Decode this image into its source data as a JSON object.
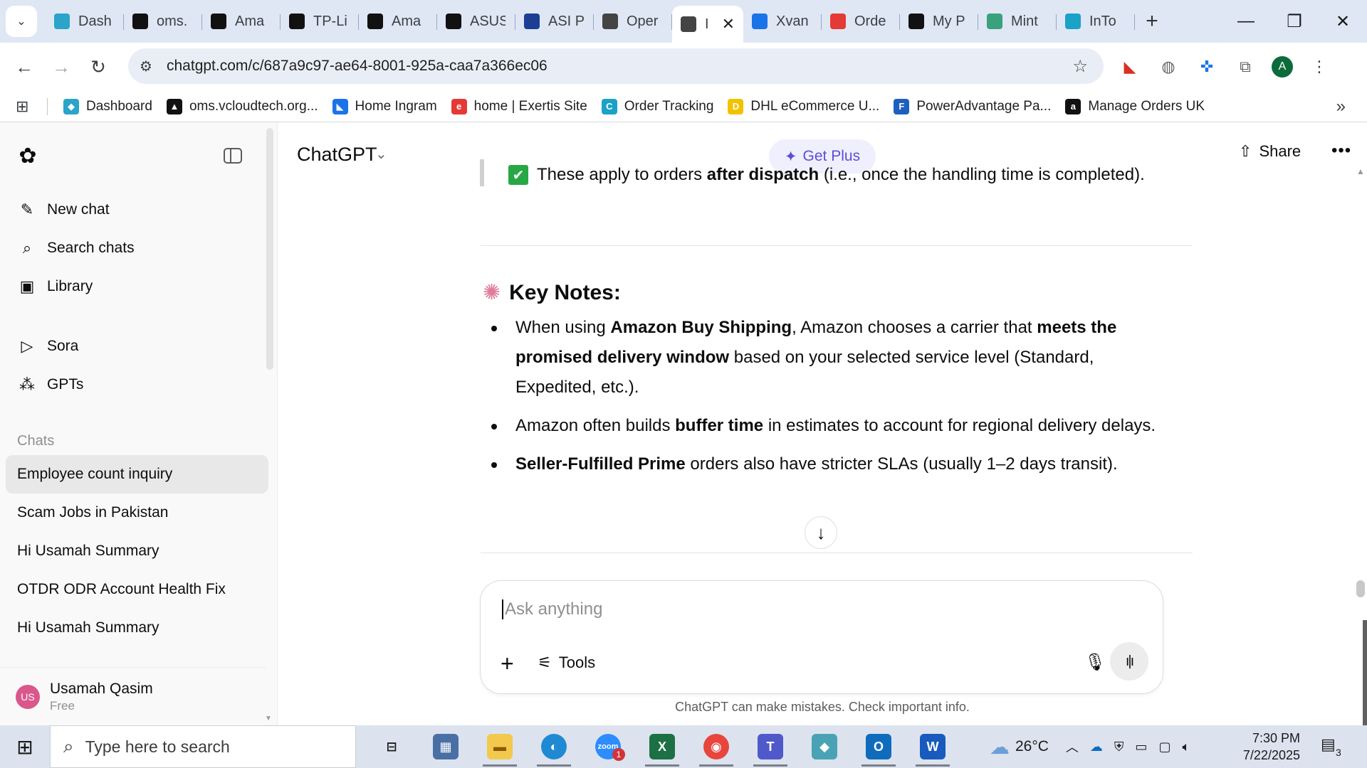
{
  "browser": {
    "tabs": [
      {
        "label": "Dash",
        "icon": "dashboard-favicon",
        "color": "#2aa4c8"
      },
      {
        "label": "oms.",
        "icon": "oms-favicon",
        "color": "#111111"
      },
      {
        "label": "Ama",
        "icon": "amazon-favicon",
        "color": "#111111"
      },
      {
        "label": "TP-Li",
        "icon": "amazon-favicon",
        "color": "#111111"
      },
      {
        "label": "Ama",
        "icon": "amazon-favicon",
        "color": "#111111"
      },
      {
        "label": "ASUS",
        "icon": "amazon-favicon",
        "color": "#111111"
      },
      {
        "label": "ASI P",
        "icon": "asi-favicon",
        "color": "#1c3f94"
      },
      {
        "label": "Oper",
        "icon": "openai-favicon",
        "color": "#444444"
      },
      {
        "label": "I",
        "icon": "openai-favicon",
        "color": "#444444",
        "active": true
      },
      {
        "label": "Xvan",
        "icon": "xvantage-favicon",
        "color": "#1a73e8"
      },
      {
        "label": "Orde",
        "icon": "exertis-favicon",
        "color": "#e53935"
      },
      {
        "label": "My P",
        "icon": "myp-favicon",
        "color": "#111111"
      },
      {
        "label": "Mint",
        "icon": "mint-favicon",
        "color": "#3aa17e"
      },
      {
        "label": "InTo",
        "icon": "into-favicon",
        "color": "#1aa2c7"
      }
    ],
    "url": "chatgpt.com/c/687a9c97-ae64-8001-925a-caa7a366ec06",
    "profile_initial": "A",
    "bookmarks": [
      {
        "label": "Dashboard",
        "color": "#2aa4c8",
        "glyph": "◆"
      },
      {
        "label": "oms.vcloudtech.org...",
        "color": "#111111",
        "glyph": "▲"
      },
      {
        "label": "Home Ingram",
        "color": "#1a73e8",
        "glyph": "◣"
      },
      {
        "label": "home | Exertis Site",
        "color": "#e53935",
        "glyph": "e"
      },
      {
        "label": "Order Tracking",
        "color": "#1aa2c7",
        "glyph": "C"
      },
      {
        "label": "DHL eCommerce U...",
        "color": "#f2c200",
        "glyph": "D"
      },
      {
        "label": "PowerAdvantage Pa...",
        "color": "#1f5fbf",
        "glyph": "F"
      },
      {
        "label": "Manage Orders UK",
        "color": "#111111",
        "glyph": "a"
      }
    ]
  },
  "sidebar": {
    "nav": [
      {
        "label": "New chat",
        "icon": "compose-icon",
        "glyph": "✎"
      },
      {
        "label": "Search chats",
        "icon": "search-icon",
        "glyph": "⌕"
      },
      {
        "label": "Library",
        "icon": "library-icon",
        "glyph": "▣"
      }
    ],
    "nav2": [
      {
        "label": "Sora",
        "icon": "play-icon",
        "glyph": "▷"
      },
      {
        "label": "GPTs",
        "icon": "grid-icon",
        "glyph": "⁂"
      }
    ],
    "section_title": "Chats",
    "chats": [
      "Employee count inquiry",
      "Scam Jobs in Pakistan",
      "Hi Usamah Summary",
      "OTDR ODR Account Health Fix",
      "Hi Usamah Summary"
    ],
    "user": {
      "initials": "US",
      "name": "Usamah Qasim",
      "plan": "Free"
    }
  },
  "header": {
    "model": "ChatGPT",
    "get_plus": "Get Plus",
    "share": "Share"
  },
  "message": {
    "check_line": {
      "pre": "These apply to orders ",
      "bold": "after dispatch",
      "post": " (i.e., once the handling time is completed)."
    },
    "heading": "Key Notes:",
    "b1": {
      "t1": "When using ",
      "b1": "Amazon Buy Shipping",
      "t2": ", Amazon chooses a carrier that ",
      "b2": "meets the promised delivery window",
      "t3": " based on your selected service level (Standard, Expedited, etc.)."
    },
    "b2": {
      "t1": "Amazon often builds ",
      "b1": "buffer time",
      "t2": " in estimates to account for regional delivery delays."
    },
    "b3": {
      "b1": "Seller-Fulfilled Prime",
      "t1": " orders also have stricter SLAs (usually 1–2 days transit)."
    }
  },
  "composer": {
    "placeholder": "Ask anything",
    "tools": "Tools"
  },
  "disclaimer": "ChatGPT can make mistakes. Check important info.",
  "taskbar": {
    "search_placeholder": "Type here to search",
    "weather": "26°C",
    "time": "7:30 PM",
    "date": "7/22/2025",
    "notifications": "3",
    "apps": [
      {
        "name": "task-view",
        "glyph": "⊟",
        "color": "#dce3ee",
        "fg": "#1a1a1a"
      },
      {
        "name": "calculator",
        "glyph": "▦",
        "color": "#4a6fa5",
        "fg": "#ffffff"
      },
      {
        "name": "file-explorer",
        "glyph": "▬",
        "color": "#f2c94c",
        "fg": "#8a5a00",
        "running": true
      },
      {
        "name": "edge",
        "glyph": "◐",
        "color": "#1f8ad3",
        "fg": "#ffffff",
        "running": true
      },
      {
        "name": "zoom",
        "glyph": "zoom",
        "color": "#2d8cff",
        "fg": "#ffffff",
        "badge": "1"
      },
      {
        "name": "excel",
        "glyph": "X",
        "color": "#1d7044",
        "fg": "#ffffff",
        "running": true
      },
      {
        "name": "chrome",
        "glyph": "◉",
        "color": "#e8453c",
        "fg": "#ffffff",
        "running": true
      },
      {
        "name": "teams",
        "glyph": "T",
        "color": "#5059c9",
        "fg": "#ffffff",
        "running": true
      },
      {
        "name": "app-diamond",
        "glyph": "◆",
        "color": "#4aa3b5",
        "fg": "#ffffff"
      },
      {
        "name": "outlook",
        "glyph": "O",
        "color": "#0f6cbd",
        "fg": "#ffffff",
        "running": true
      },
      {
        "name": "word",
        "glyph": "W",
        "color": "#185abd",
        "fg": "#ffffff",
        "running": true
      }
    ]
  }
}
